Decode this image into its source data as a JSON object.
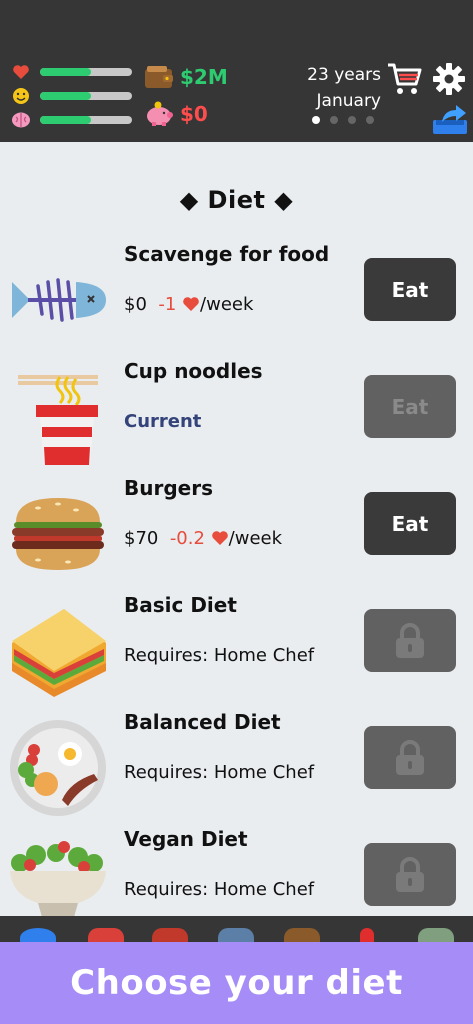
{
  "status": {
    "health_fill": 0.55,
    "happiness_fill": 0.55,
    "smarts_fill": 0.55,
    "net_worth": "$2M",
    "cash": "$0",
    "age": "23 years",
    "month": "January",
    "page_dots": 4,
    "active_dot": 0
  },
  "section": {
    "title": "◆ Diet ◆"
  },
  "diets": [
    {
      "name": "Scavenge for food",
      "price": "$0",
      "effect": "-1",
      "per": "/week",
      "button": "Eat",
      "state": "enabled",
      "icon": "fish-skeleton-icon"
    },
    {
      "name": "Cup noodles",
      "status": "Current",
      "button": "Eat",
      "state": "disabled",
      "icon": "cup-noodles-icon"
    },
    {
      "name": "Burgers",
      "price": "$70",
      "effect": "-0.2",
      "per": "/week",
      "button": "Eat",
      "state": "enabled",
      "icon": "burger-icon"
    },
    {
      "name": "Basic Diet",
      "requires": "Requires: Home Chef",
      "state": "locked",
      "icon": "sandwich-icon"
    },
    {
      "name": "Balanced Diet",
      "requires": "Requires: Home Chef",
      "state": "locked",
      "icon": "balanced-plate-icon"
    },
    {
      "name": "Vegan Diet",
      "requires": "Requires: Home Chef",
      "state": "locked",
      "icon": "salad-bowl-icon"
    }
  ],
  "banner": {
    "text": "Choose your diet"
  },
  "colors": {
    "topbar": "#363636",
    "accent_green": "#2ecc71",
    "accent_red": "#ff4d4d",
    "banner": "#a58cf7",
    "current": "#34437a"
  }
}
